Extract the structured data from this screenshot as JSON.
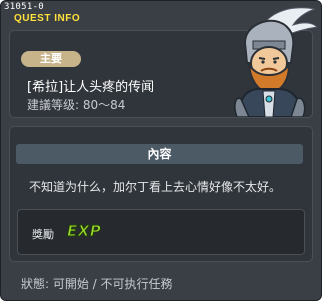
{
  "header": {
    "quest_id": "31051-0",
    "title": "QUEST INFO"
  },
  "quest": {
    "tag": "主要",
    "name": "[希拉]让人头疼的传闻",
    "level": "建議等级: 80～84"
  },
  "content": {
    "header": "內容",
    "text": "不知道为什么，加尔丁看上去心情好像不太好。"
  },
  "reward": {
    "label": "獎勵",
    "exp_text": "EXP"
  },
  "status": {
    "text": "狀態: 可開始 / 不可执行任務"
  },
  "colors": {
    "title": "#ffe23a",
    "tag_bg": "#c8b48a",
    "exp": "#9bd82a",
    "window_bg": "#3a3f45"
  },
  "icons": {
    "portrait": "knight-npc-portrait"
  }
}
